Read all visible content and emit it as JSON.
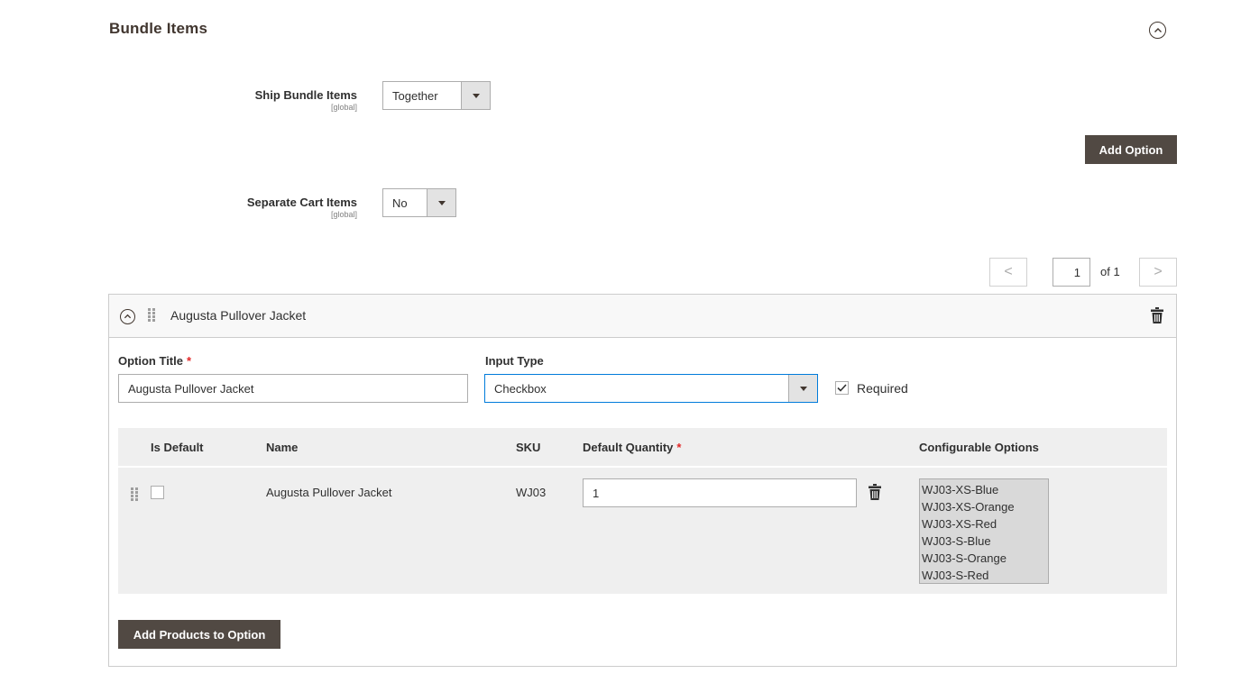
{
  "section": {
    "title": "Bundle Items"
  },
  "ship_bundle_items": {
    "label": "Ship Bundle Items",
    "scope": "[global]",
    "value": "Together"
  },
  "separate_cart_items": {
    "label": "Separate Cart Items",
    "scope": "[global]",
    "value": "No"
  },
  "add_option_label": "Add Option",
  "pager": {
    "prev": "<",
    "next": ">",
    "current": "1",
    "of_label": "of 1"
  },
  "option": {
    "header_title": "Augusta Pullover Jacket",
    "title_label": "Option Title",
    "title_value": "Augusta Pullover Jacket",
    "required_mark": "*",
    "input_type_label": "Input Type",
    "input_type_value": "Checkbox",
    "required_label": "Required",
    "required_checked": true
  },
  "grid": {
    "headers": {
      "is_default": "Is Default",
      "name": "Name",
      "sku": "SKU",
      "default_quantity": "Default Quantity",
      "configurable_options": "Configurable Options"
    },
    "rows": [
      {
        "name": "Augusta Pullover Jacket",
        "sku": "WJ03",
        "quantity": "1",
        "configurable_options": [
          "WJ03-XS-Blue",
          "WJ03-XS-Orange",
          "WJ03-XS-Red",
          "WJ03-S-Blue",
          "WJ03-S-Orange",
          "WJ03-S-Red"
        ]
      }
    ]
  },
  "add_products_label": "Add Products to Option",
  "icons": {
    "collapse": "chevron-up-circle-icon",
    "drag": "drag-handle-icon",
    "delete": "trash-icon",
    "checkmark": "checkmark-icon"
  },
  "colors": {
    "button_dark": "#514943",
    "required": "#e22626",
    "grid_bg": "#efefef"
  }
}
